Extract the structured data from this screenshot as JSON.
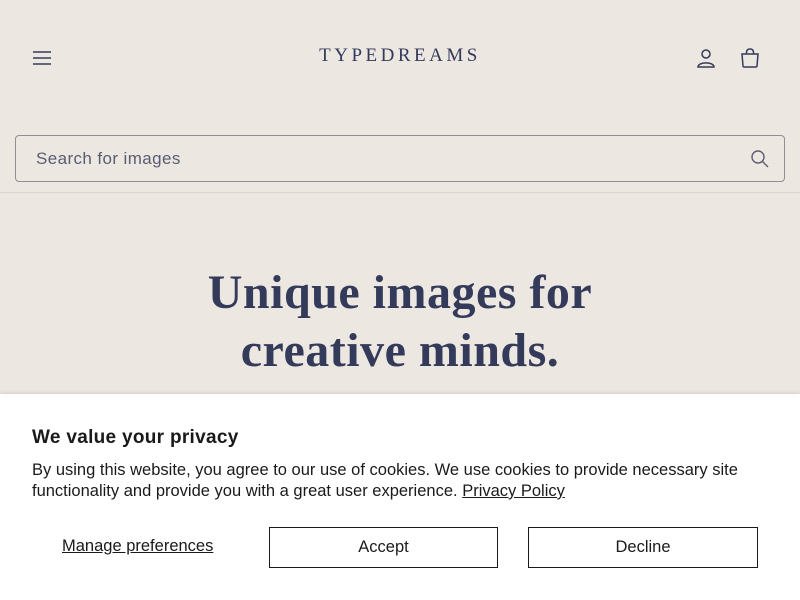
{
  "header": {
    "logo": "TYPEDREAMS",
    "icons": {
      "menu": "hamburger-menu-icon",
      "account": "user-account-icon",
      "cart": "shopping-bag-icon"
    }
  },
  "search": {
    "placeholder": "Search for images",
    "value": "",
    "icon": "search-icon"
  },
  "hero": {
    "title_line1": "Unique images for",
    "title_line2": "creative minds."
  },
  "cookie_banner": {
    "title": "We value your privacy",
    "text": "By using this website, you agree to our use of cookies. We use cookies to provide necessary site functionality and provide you with a great user experience.",
    "link_label": "Privacy Policy",
    "manage_label": "Manage preferences",
    "accept_label": "Accept",
    "decline_label": "Decline"
  },
  "colors": {
    "background": "#ece7e1",
    "brand_text": "#343a5a",
    "banner_bg": "#ffffff",
    "banner_text": "#1a1a1a"
  }
}
